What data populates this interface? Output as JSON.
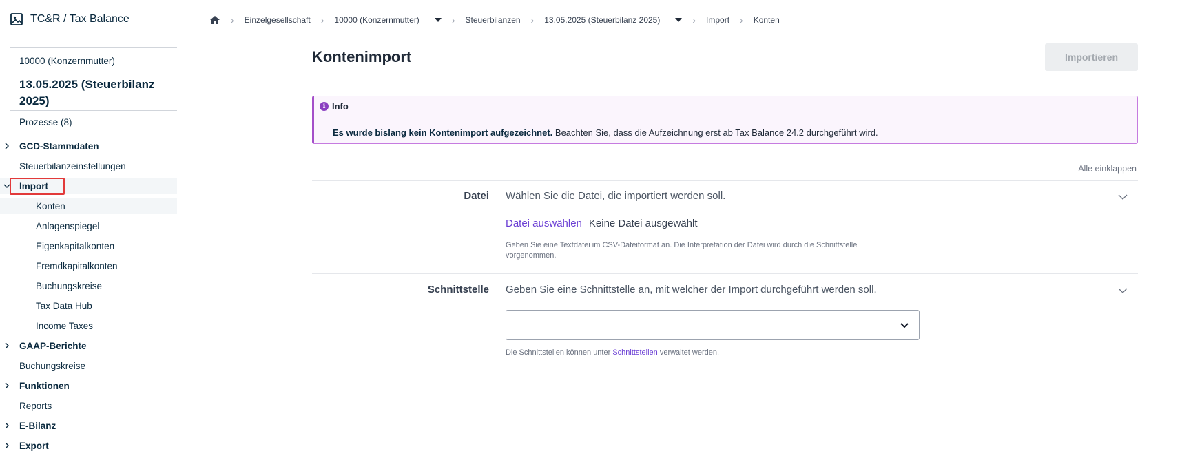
{
  "app": {
    "title": "TC&R / Tax Balance"
  },
  "sidebar": {
    "entity": "10000 (Konzernmutter)",
    "balance": "13.05.2025 (Steuerbilanz 2025)",
    "processes": "Prozesse (8)",
    "items": [
      {
        "label": "GCD-Stammdaten"
      },
      {
        "label": "Steuerbilanzeinstellungen"
      },
      {
        "label": "Import"
      },
      {
        "label": "Konten"
      },
      {
        "label": "Anlagenspiegel"
      },
      {
        "label": "Eigenkapitalkonten"
      },
      {
        "label": "Fremdkapitalkonten"
      },
      {
        "label": "Buchungskreise"
      },
      {
        "label": "Tax Data Hub"
      },
      {
        "label": "Income Taxes"
      },
      {
        "label": "GAAP-Berichte"
      },
      {
        "label": "Buchungskreise"
      },
      {
        "label": "Funktionen"
      },
      {
        "label": "Reports"
      },
      {
        "label": "E-Bilanz"
      },
      {
        "label": "Export"
      }
    ]
  },
  "breadcrumb": [
    "Einzelgesellschaft",
    "10000 (Konzernmutter)",
    "Steuerbilanzen",
    "13.05.2025 (Steuerbilanz 2025)",
    "Import",
    "Konten"
  ],
  "page": {
    "title": "Kontenimport",
    "import_button": "Importieren",
    "collapse_all": "Alle einklappen"
  },
  "info": {
    "title": "Info",
    "bold_text": "Es wurde bislang kein Kontenimport aufgezeichnet.",
    "text": " Beachten Sie, dass die Aufzeichnung erst ab Tax Balance 24.2 durchgeführt wird."
  },
  "file_section": {
    "label": "Datei",
    "description": "Wählen Sie die Datei, die importiert werden soll.",
    "choose_file": "Datei auswählen",
    "no_file": "Keine Datei ausgewählt",
    "hint_line1": "Geben Sie eine Textdatei im CSV-Dateiformat an. Die Interpretation der Datei wird durch die Schnittstelle",
    "hint_line2": "vorgenommen."
  },
  "interface_section": {
    "label": "Schnittstelle",
    "description": "Geben Sie eine Schnittstelle an, mit welcher der Import durchgeführt werden soll.",
    "selected_value": "",
    "hint_prefix": "Die Schnittstellen können unter ",
    "hint_link": "Schnittstellen",
    "hint_suffix": " verwaltet werden."
  },
  "colors": {
    "accent": "#6b3fd4",
    "info_border": "#a44fc9",
    "info_bg": "#fbf5fd",
    "highlight_box": "#e23a3a"
  }
}
